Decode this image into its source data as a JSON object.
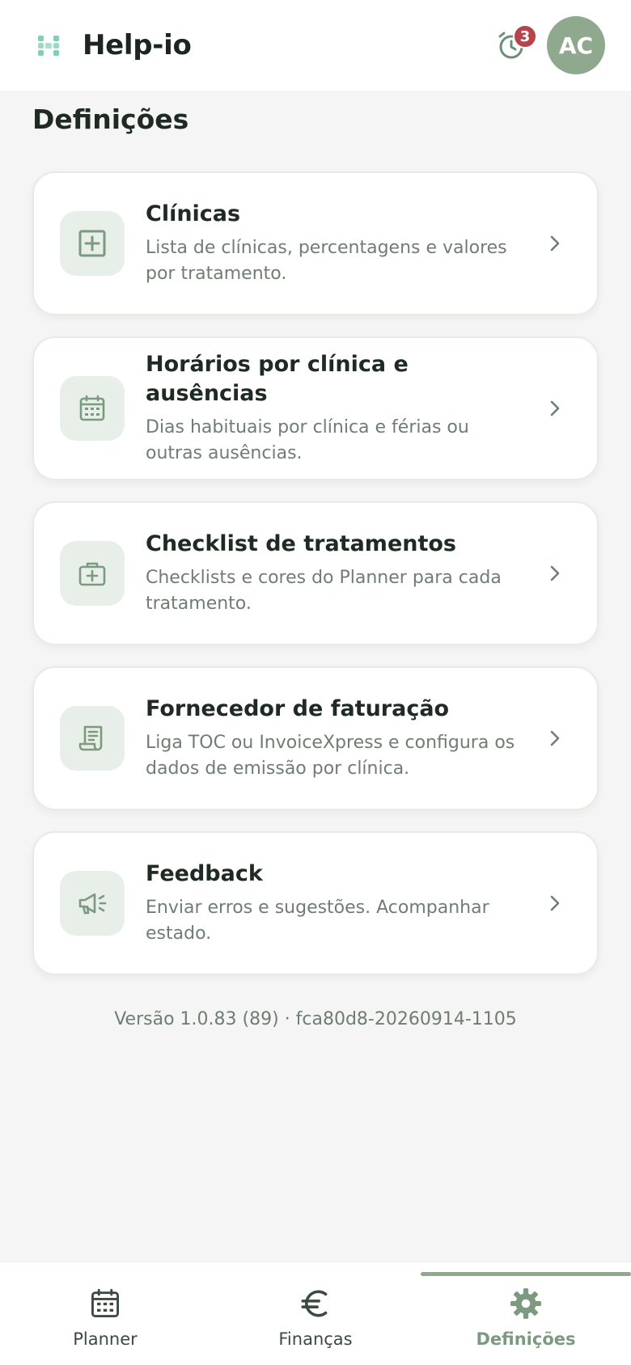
{
  "header": {
    "app_name": "Help-io",
    "notification_count": "3",
    "avatar_initials": "AC"
  },
  "page": {
    "title": "Definições"
  },
  "items": [
    {
      "title": "Clínicas",
      "description": "Lista de clínicas, percentagens e valores por tratamento.",
      "icon": "clinic-plus-icon"
    },
    {
      "title": "Horários por clínica e ausências",
      "description": "Dias habituais por clínica e férias ou outras ausências.",
      "icon": "calendar-icon"
    },
    {
      "title": "Checklist de tratamentos",
      "description": "Checklists e cores do Planner para cada tratamento.",
      "icon": "medical-kit-icon"
    },
    {
      "title": "Fornecedor de faturação",
      "description": "Liga TOC ou InvoiceXpress e configura os dados de emissão por clínica.",
      "icon": "receipt-icon"
    },
    {
      "title": "Feedback",
      "description": "Enviar erros e sugestões. Acompanhar estado.",
      "icon": "megaphone-icon"
    }
  ],
  "version_text": "Versão 1.0.83 (89) · fca80d8-20260914-1105",
  "nav": {
    "items": [
      {
        "label": "Planner",
        "icon": "calendar-icon",
        "active": false
      },
      {
        "label": "Finanças",
        "icon": "euro-icon",
        "active": false
      },
      {
        "label": "Definições",
        "icon": "gear-icon",
        "active": true
      }
    ]
  },
  "colors": {
    "accent": "#8fa98f",
    "badge": "#b8444b",
    "logo": "#7fd0b6"
  }
}
